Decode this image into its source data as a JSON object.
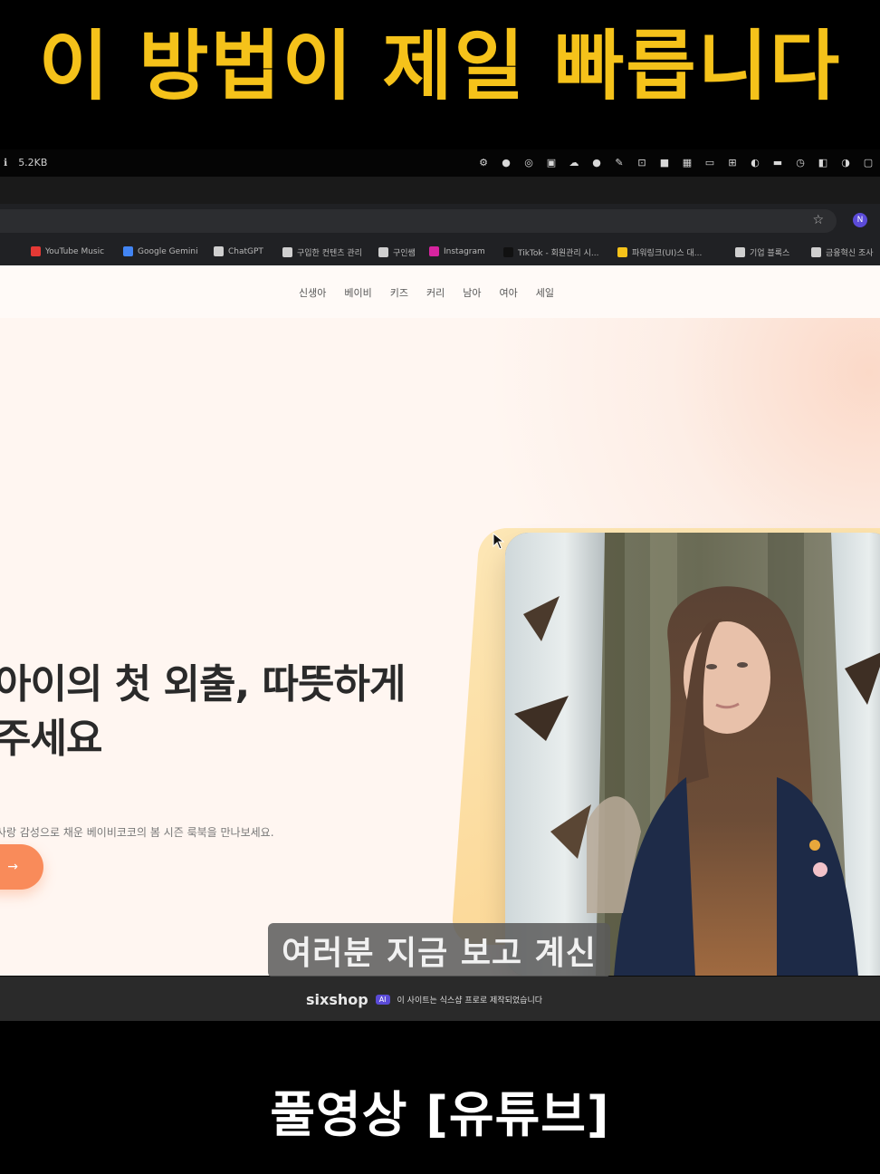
{
  "captions": {
    "top": "이 방법이 제일 빠릅니다",
    "video_subtitle": "여러분 지금 보고 계신",
    "bottom": "풀영상 [유튜브]"
  },
  "os_bar": {
    "left_items": [
      "ℹ",
      "5.2KB"
    ]
  },
  "bookmarks": [
    {
      "label": "YouTube Music",
      "color": "#e53935"
    },
    {
      "label": "Google Gemini",
      "color": "#4285f4"
    },
    {
      "label": "ChatGPT",
      "color": "#cfcfcf"
    },
    {
      "label": "구입한 컨텐츠 관리",
      "color": "#cfcfcf"
    },
    {
      "label": "구인쌤",
      "color": "#cfcfcf"
    },
    {
      "label": "Instagram",
      "color": "#d6249f"
    },
    {
      "label": "TikTok - 회원관리 시...",
      "color": "#111111"
    },
    {
      "label": "파워링크(UI)스 대...",
      "color": "#f5c21a"
    },
    {
      "label": "기업 블록스",
      "color": "#cfcfcf"
    },
    {
      "label": "금융혁신 조사",
      "color": "#cfcfcf"
    }
  ],
  "site": {
    "nav": [
      "신생아",
      "베이비",
      "키즈",
      "커리",
      "남아",
      "여아",
      "세일"
    ],
    "hero_title_line1": "아이의 첫 외출, 따뜻하게",
    "hero_title_line2": "주세요",
    "hero_subtitle": "사랑 감성으로 채운 베이비코코의 봄 시즌 룩북을 만나보세요.",
    "cta_arrow": "→"
  },
  "footer": {
    "logo": "sixshop",
    "badge": "AI",
    "text": "이 사이트는 식스샵 프로로 제작되었습니다"
  }
}
